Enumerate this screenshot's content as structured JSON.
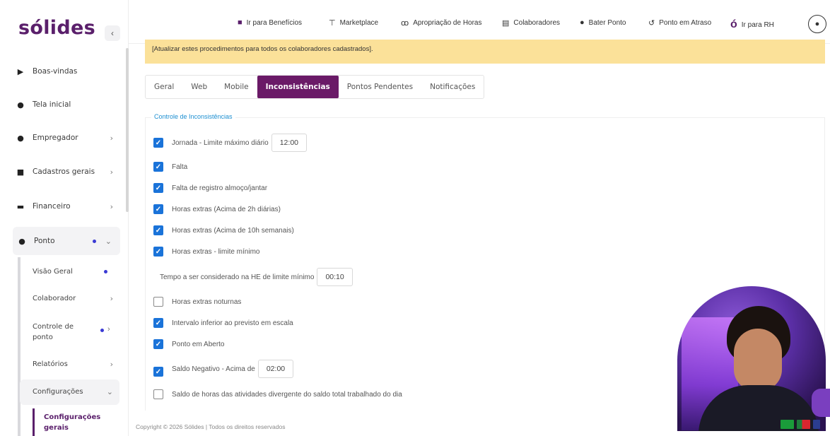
{
  "sidebar": {
    "logo": "sólides",
    "collapse_icon": "‹",
    "items": [
      {
        "label": "Boas-vindas",
        "icon": "play-icon"
      },
      {
        "label": "Tela inicial",
        "icon": "home-icon"
      },
      {
        "label": "Empregador",
        "icon": "user-circle-icon"
      },
      {
        "label": "Cadastros gerais",
        "icon": "folder-icon"
      },
      {
        "label": "Financeiro",
        "icon": "money-icon"
      },
      {
        "label": "Ponto",
        "icon": "clock-icon"
      }
    ],
    "sub_items": [
      {
        "label": "Visão Geral"
      },
      {
        "label": "Colaborador"
      },
      {
        "label": "Controle de ponto"
      },
      {
        "label": "Relatórios"
      },
      {
        "label": "Configurações"
      }
    ],
    "sub_sub_item": "Configurações gerais"
  },
  "topbar": {
    "links": [
      {
        "label": "Ir para Benefícios",
        "icon": "gift-icon"
      },
      {
        "label": "Marketplace",
        "icon": "cart-icon"
      },
      {
        "label": "Apropriação de Horas",
        "icon": "people-icon"
      },
      {
        "label": "Colaboradores",
        "icon": "list-icon"
      },
      {
        "label": "Bater Ponto",
        "icon": "clock-icon"
      },
      {
        "label": "Ponto em Atraso",
        "icon": "history-icon"
      },
      {
        "label": "Ir para RH",
        "icon": "logo-mark-icon"
      }
    ]
  },
  "notice": "[Atualizar estes procedimentos para todos os colaboradores cadastrados].",
  "tabs": [
    {
      "label": "Geral"
    },
    {
      "label": "Web"
    },
    {
      "label": "Mobile"
    },
    {
      "label": "Inconsistências",
      "active": true
    },
    {
      "label": "Pontos Pendentes"
    },
    {
      "label": "Notificações"
    }
  ],
  "section": {
    "legend": "Controle de Inconsistências",
    "options": [
      {
        "label": "Jornada - Limite máximo diário",
        "checked": true,
        "value": "12:00"
      },
      {
        "label": "Falta",
        "checked": true
      },
      {
        "label": "Falta de registro almoço/jantar",
        "checked": true
      },
      {
        "label": "Horas extras (Acima de 2h diárias)",
        "checked": true
      },
      {
        "label": "Horas extras (Acima de 10h semanais)",
        "checked": true
      },
      {
        "label": "Horas extras - limite mínimo",
        "checked": true
      },
      {
        "label": "Horas extras noturnas",
        "checked": false
      },
      {
        "label": "Intervalo inferior ao previsto em escala",
        "checked": true
      },
      {
        "label": "Ponto em Aberto",
        "checked": true
      },
      {
        "label": "Saldo Negativo - Acima de",
        "checked": true,
        "value": "02:00"
      },
      {
        "label": "Saldo de horas das atividades divergente do saldo total trabalhado do dia",
        "checked": false
      }
    ],
    "min_time": {
      "label": "Tempo a ser considerado na HE de limite mínimo",
      "value": "00:10"
    }
  },
  "footer": "Copyright © 2026 Sólides | Todos os direitos reservados",
  "colors": {
    "brand": "#5a1f6b",
    "tab_active": "#6a1a67",
    "checkbox": "#1a73d9",
    "notice_bg": "#fbe199",
    "legend": "#1d8fd1"
  }
}
